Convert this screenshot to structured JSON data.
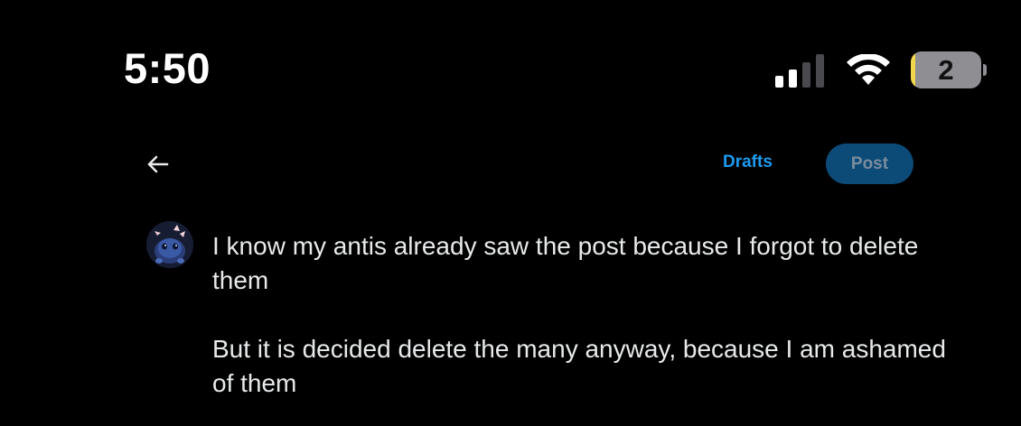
{
  "status_bar": {
    "time": "5:50",
    "signal_icon": "cellular-signal-icon",
    "signal_bars_active": 2,
    "signal_bars_total": 4,
    "wifi_icon": "wifi-icon",
    "battery_level": "2",
    "battery_fill_fraction": 0.02,
    "battery_fill_color": "#f2d64b"
  },
  "toolbar": {
    "back_icon": "back-arrow-icon",
    "drafts_label": "Drafts",
    "post_label": "Post"
  },
  "composer": {
    "avatar_icon": "avatar-image",
    "paragraphs": [
      "I know my antis already saw the post because I forgot to delete them",
      "But it is decided delete the many anyway, because I am ashamed of them"
    ]
  },
  "colors": {
    "background": "#000000",
    "accent": "#1d9bf0",
    "post_button_bg": "#0c4a78",
    "post_button_text": "#7a8d9c",
    "text": "#e7e9ea"
  }
}
